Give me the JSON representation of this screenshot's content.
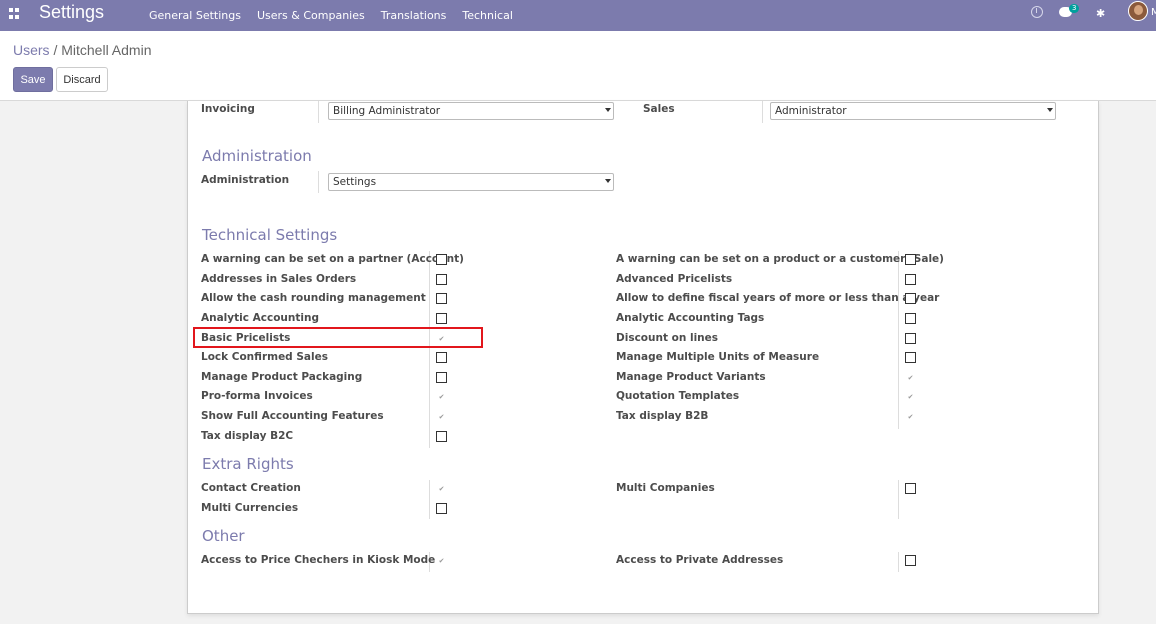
{
  "navbar": {
    "brand": "Settings",
    "menu": [
      "General Settings",
      "Users & Companies",
      "Translations",
      "Technical"
    ],
    "chat_badge": "3",
    "user_initial": "M",
    "color": "#7c7bad"
  },
  "breadcrumb": {
    "parent": "Users",
    "separator": " / ",
    "current": "Mitchell Admin"
  },
  "buttons": {
    "save": "Save",
    "discard": "Discard"
  },
  "access": {
    "invoicing_label": "Invoicing",
    "invoicing_value": "Billing Administrator",
    "sales_label": "Sales",
    "sales_value": "Administrator"
  },
  "administration": {
    "title": "Administration",
    "label": "Administration",
    "value": "Settings"
  },
  "technical": {
    "title": "Technical Settings",
    "left": [
      {
        "label": "A warning can be set on a partner (Account)",
        "checked": false
      },
      {
        "label": "Addresses in Sales Orders",
        "checked": false
      },
      {
        "label": "Allow the cash rounding management",
        "checked": false
      },
      {
        "label": "Analytic Accounting",
        "checked": false
      },
      {
        "label": "Basic Pricelists",
        "checked": true
      },
      {
        "label": "Lock Confirmed Sales",
        "checked": false
      },
      {
        "label": "Manage Product Packaging",
        "checked": false
      },
      {
        "label": "Pro-forma Invoices",
        "checked": true
      },
      {
        "label": "Show Full Accounting Features",
        "checked": true
      },
      {
        "label": "Tax display B2C",
        "checked": false
      }
    ],
    "right": [
      {
        "label": "A warning can be set on a product or a customer (Sale)",
        "checked": false
      },
      {
        "label": "Advanced Pricelists",
        "checked": false
      },
      {
        "label": "Allow to define fiscal years of more or less than a year",
        "checked": false
      },
      {
        "label": "Analytic Accounting Tags",
        "checked": false
      },
      {
        "label": "Discount on lines",
        "checked": false
      },
      {
        "label": "Manage Multiple Units of Measure",
        "checked": false
      },
      {
        "label": "Manage Product Variants",
        "checked": true
      },
      {
        "label": "Quotation Templates",
        "checked": true
      },
      {
        "label": "Tax display B2B",
        "checked": true
      }
    ]
  },
  "extra_rights": {
    "title": "Extra Rights",
    "left": [
      {
        "label": "Contact Creation",
        "checked": true
      },
      {
        "label": "Multi Currencies",
        "checked": false
      }
    ],
    "right": [
      {
        "label": "Multi Companies",
        "checked": false
      }
    ]
  },
  "other": {
    "title": "Other",
    "left": [
      {
        "label": "Access to Price Chechers in Kiosk Mode",
        "checked": true
      }
    ],
    "right": [
      {
        "label": "Access to Private Addresses",
        "checked": false
      }
    ]
  }
}
